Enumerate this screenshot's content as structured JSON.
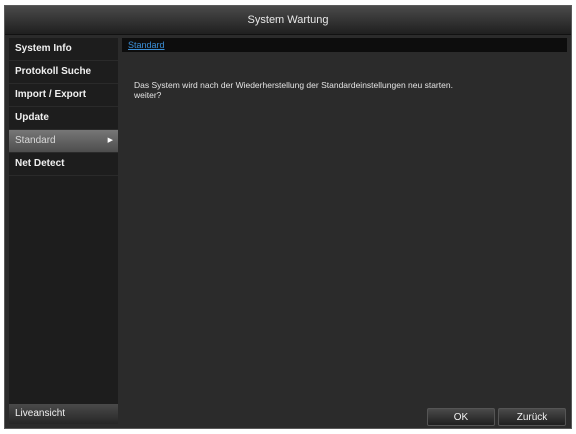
{
  "window": {
    "title": "System Wartung"
  },
  "sidebar": {
    "items": [
      {
        "label": "System Info"
      },
      {
        "label": "Protokoll Suche"
      },
      {
        "label": "Import / Export"
      },
      {
        "label": "Update"
      },
      {
        "label": "Standard",
        "arrow": "▶"
      },
      {
        "label": "Net Detect"
      }
    ],
    "live_label": "Liveansicht"
  },
  "main": {
    "tab_label": "Standard",
    "message_line1": "Das System wird nach der Wiederherstellung der Standardeinstellungen neu starten.",
    "message_line2": "weiter?"
  },
  "buttons": {
    "ok": "OK",
    "back": "Zurück"
  },
  "colors": {
    "background": "#2b2b2b",
    "sidebar": "#1d1d1d",
    "active_item": "#5e5e5e",
    "tab_link": "#3c8fd6"
  }
}
